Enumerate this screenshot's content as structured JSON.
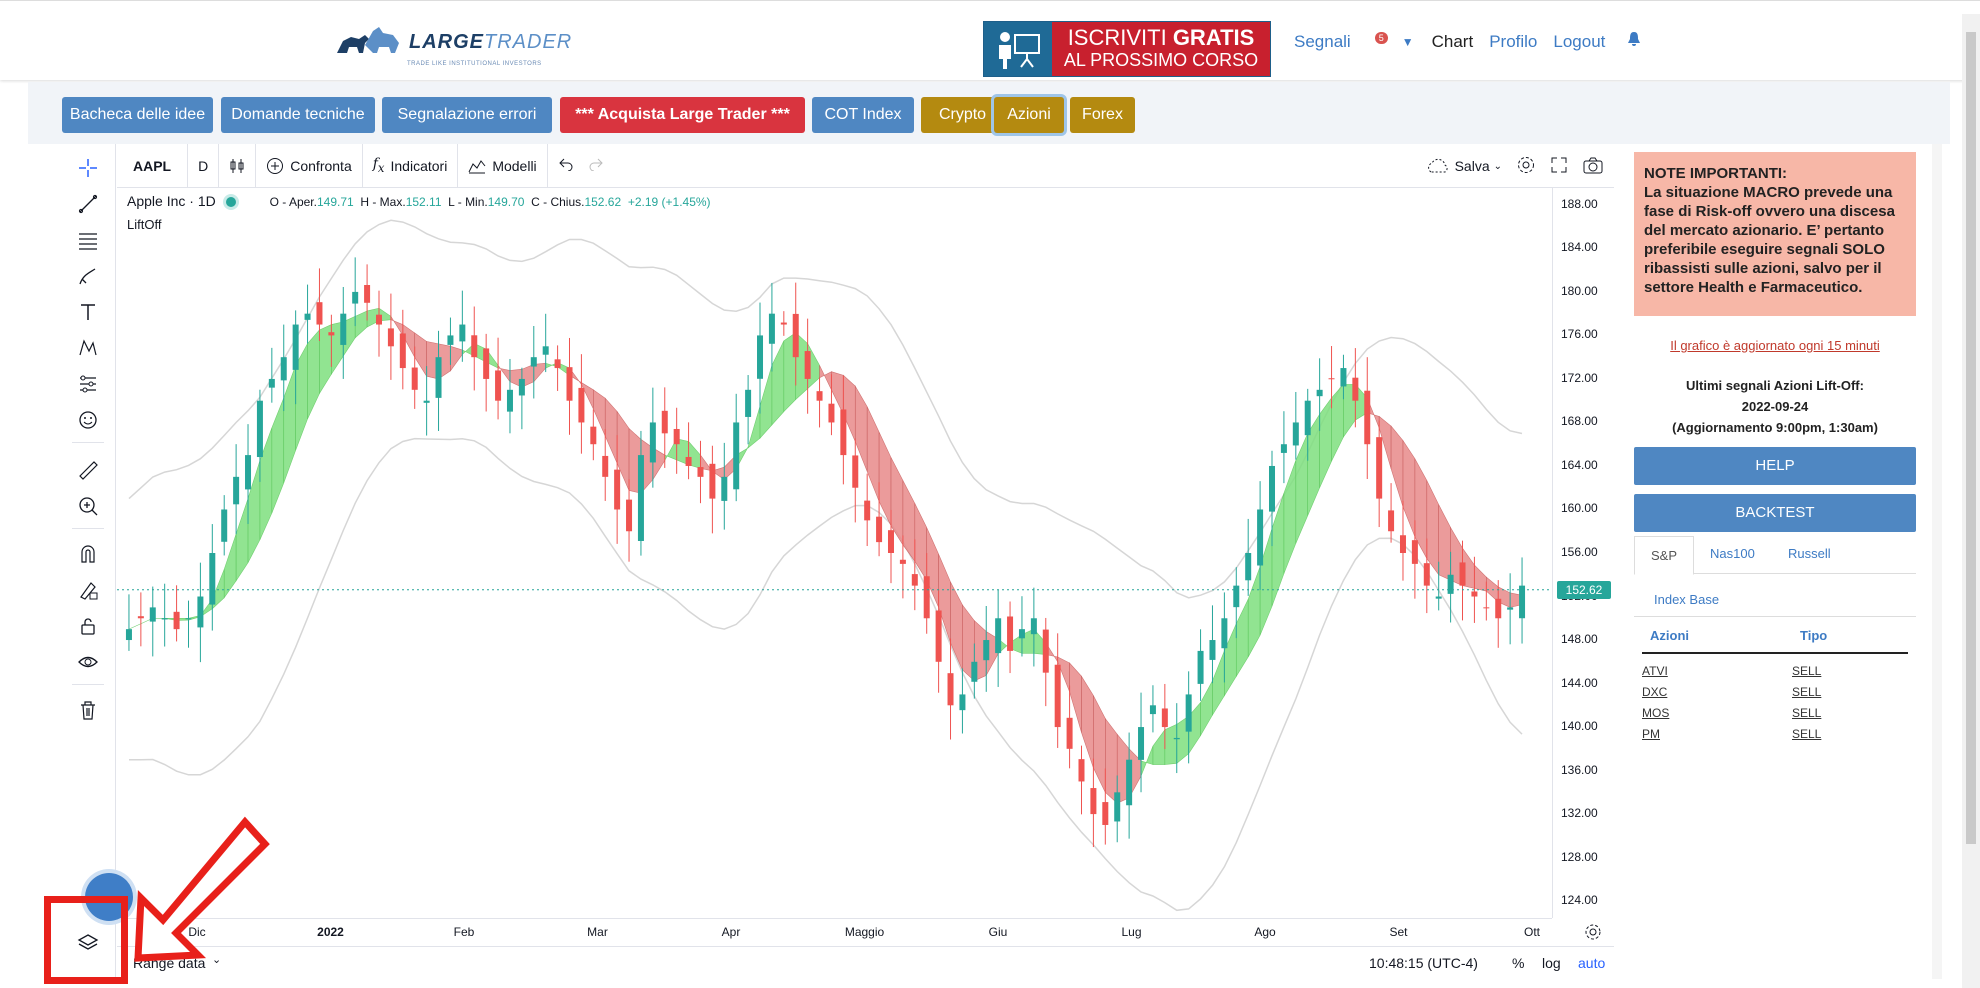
{
  "brand": {
    "name_bold": "LARGE",
    "name_light": "TRADER",
    "tagline": "TRADE LIKE INSTITUTIONAL INVESTORS"
  },
  "banner": {
    "line1_a": "ISCRIVITI ",
    "line1_b": "GRATIS",
    "line2": "AL PROSSIMO CORSO"
  },
  "nav": {
    "signals": "Segnali",
    "signals_count": "5",
    "chart": "Chart",
    "profile": "Profilo",
    "logout": "Logout"
  },
  "toolbar_buttons": [
    "Bacheca delle idee",
    "Domande tecniche",
    "Segnalazione errori",
    "*** Acquista Large Trader ***",
    "COT Index",
    "Crypto",
    "Azioni",
    "Forex"
  ],
  "chart_toolbar": {
    "symbol": "AAPL",
    "interval": "D",
    "compare": "Confronta",
    "indicators": "Indicatori",
    "templates": "Modelli",
    "save": "Salva"
  },
  "legend": {
    "title": "Apple Inc · 1D",
    "open_label": "O - Aper.",
    "open": "149.71",
    "high_label": "H - Max.",
    "high": "152.11",
    "low_label": "L - Min.",
    "low": "149.70",
    "close_label": "C - Chius.",
    "close": "152.62",
    "change": "+2.19 (+1.45%)",
    "indicator": "LiftOff"
  },
  "last_price": "152.62",
  "bottom_bar": {
    "range": "Range data",
    "time": "10:48:15 (UTC-4)",
    "percent": "%",
    "log": "log",
    "auto": "auto"
  },
  "sidebar": {
    "note_title": "NOTE IMPORTANTI:",
    "note_text": "La situazione MACRO prevede una fase di Risk-off ovvero una discesa del mercato azionario. E’ pertanto preferibile eseguire segnali SOLO ribassisti sulle azioni, salvo per il settore Health e Farmaceutico.",
    "update_text": "Il grafico è aggiornato ogni 15 minuti",
    "last_signals_title": "Ultimi segnali Azioni Lift-Off:",
    "last_signals_date": "2022-09-24",
    "last_signals_update": "(Aggiornamento 9:00pm, 1:30am)",
    "help": "HELP",
    "backtest": "BACKTEST",
    "tabs": [
      "S&P",
      "Nas100",
      "Russell"
    ],
    "index_base": "Index Base",
    "table_headers": [
      "Azioni",
      "Tipo"
    ],
    "signals": [
      {
        "stock": "ATVI",
        "type": "SELL"
      },
      {
        "stock": "DXC",
        "type": "SELL"
      },
      {
        "stock": "MOS",
        "type": "SELL"
      },
      {
        "stock": "PM",
        "type": "SELL"
      }
    ]
  },
  "colors": {
    "up": "#26a69a",
    "down": "#ef5350",
    "band_up": "#7ee07e",
    "band_down": "#e88a8a",
    "accent": "#4f87c2",
    "highlight": "#e8201a"
  },
  "chart_data": {
    "type": "candlestick",
    "symbol": "AAPL",
    "interval": "D",
    "y_ticks": [
      "188.00",
      "184.00",
      "180.00",
      "176.00",
      "172.00",
      "168.00",
      "164.00",
      "160.00",
      "156.00",
      "152.00",
      "148.00",
      "144.00",
      "140.00",
      "136.00",
      "132.00",
      "128.00",
      "124.00"
    ],
    "x_ticks": [
      "Dic",
      "2022",
      "Feb",
      "Mar",
      "Apr",
      "Maggio",
      "Giu",
      "Lug",
      "Ago",
      "Set",
      "Ott"
    ],
    "ylim": [
      123,
      189
    ],
    "close_series": [
      149,
      150,
      151,
      150,
      149,
      150,
      152,
      156,
      160,
      163,
      165,
      170,
      172,
      174,
      177,
      178,
      177,
      176,
      178,
      180,
      179,
      177,
      175,
      173,
      171,
      170,
      174,
      176,
      177,
      174,
      172,
      170,
      171,
      172,
      174,
      175,
      173,
      170,
      168,
      166,
      163,
      160,
      158,
      165,
      168,
      167,
      166,
      164,
      163,
      161,
      163,
      168,
      171,
      176,
      178,
      177,
      174,
      172,
      170,
      168,
      165,
      162,
      159,
      157,
      156,
      155,
      153,
      150,
      146,
      142,
      143,
      146,
      148,
      150,
      147,
      149,
      150,
      145,
      140,
      138,
      135,
      132,
      131,
      134,
      137,
      140,
      142,
      140,
      139,
      143,
      147,
      148,
      150,
      153,
      156,
      160,
      164,
      166,
      168,
      170,
      171,
      172,
      173,
      170,
      166,
      161,
      158,
      156,
      155,
      153,
      152,
      154,
      153,
      152,
      151,
      150,
      151,
      153
    ],
    "series": [
      {
        "name": "LiftOff"
      }
    ]
  }
}
